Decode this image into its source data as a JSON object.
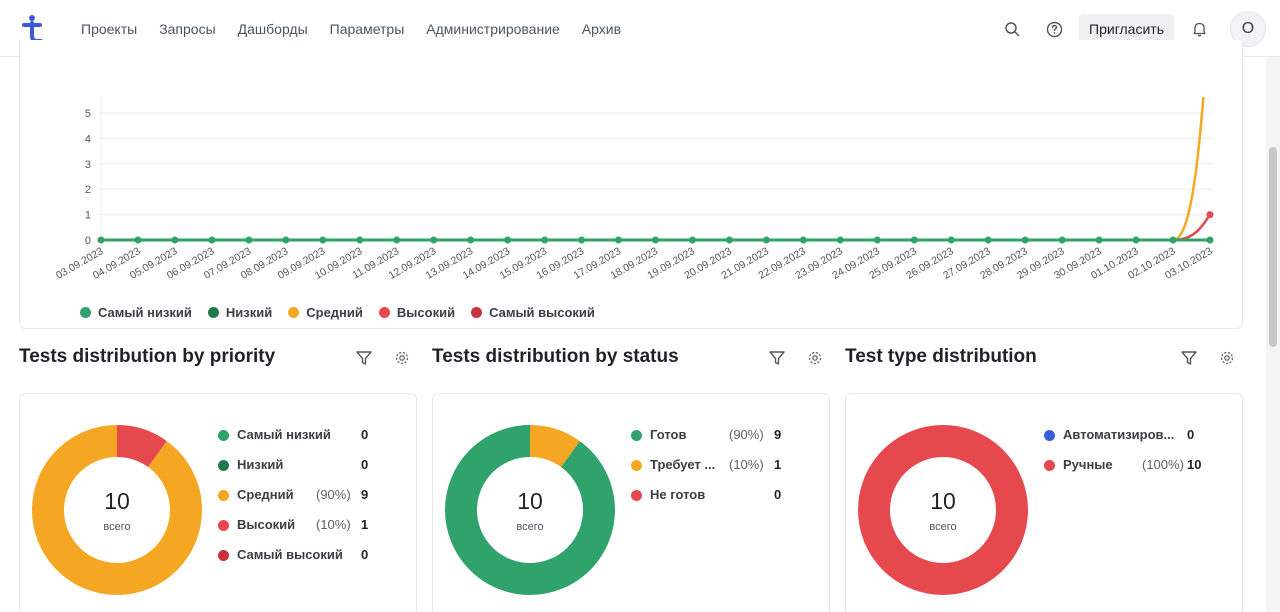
{
  "nav": {
    "items": [
      "Проекты",
      "Запросы",
      "Дашборды",
      "Параметры",
      "Администрирование",
      "Архив"
    ],
    "invite_label": "Пригласить",
    "avatar_initial": "О",
    "icons": [
      "search-icon",
      "help-icon",
      "bell-icon"
    ]
  },
  "chart_data": {
    "type": "line",
    "x": [
      "03.09.2023",
      "04.09.2023",
      "05.09.2023",
      "06.09.2023",
      "07.09.2023",
      "08.09.2023",
      "09.09.2023",
      "10.09.2023",
      "11.09.2023",
      "12.09.2023",
      "13.09.2023",
      "14.09.2023",
      "15.09.2023",
      "16.09.2023",
      "17.09.2023",
      "18.09.2023",
      "19.09.2023",
      "20.09.2023",
      "21.09.2023",
      "22.09.2023",
      "23.09.2023",
      "24.09.2023",
      "25.09.2023",
      "26.09.2023",
      "27.09.2023",
      "28.09.2023",
      "29.09.2023",
      "30.09.2023",
      "01.10.2023",
      "02.10.2023",
      "03.10.2023"
    ],
    "y_ticks": [
      0,
      1,
      2,
      3,
      4,
      5
    ],
    "series": [
      {
        "name": "Самый низкий",
        "color": "#2fa36b",
        "values": [
          0,
          0,
          0,
          0,
          0,
          0,
          0,
          0,
          0,
          0,
          0,
          0,
          0,
          0,
          0,
          0,
          0,
          0,
          0,
          0,
          0,
          0,
          0,
          0,
          0,
          0,
          0,
          0,
          0,
          0,
          0
        ]
      },
      {
        "name": "Низкий",
        "color": "#1e7a4c",
        "values": [
          0,
          0,
          0,
          0,
          0,
          0,
          0,
          0,
          0,
          0,
          0,
          0,
          0,
          0,
          0,
          0,
          0,
          0,
          0,
          0,
          0,
          0,
          0,
          0,
          0,
          0,
          0,
          0,
          0,
          0,
          0
        ]
      },
      {
        "name": "Средний",
        "color": "#f5a623",
        "values": [
          0,
          0,
          0,
          0,
          0,
          0,
          0,
          0,
          0,
          0,
          0,
          0,
          0,
          0,
          0,
          0,
          0,
          0,
          0,
          0,
          0,
          0,
          0,
          0,
          0,
          0,
          0,
          0,
          0,
          0,
          9
        ]
      },
      {
        "name": "Высокий",
        "color": "#e5484d",
        "values": [
          0,
          0,
          0,
          0,
          0,
          0,
          0,
          0,
          0,
          0,
          0,
          0,
          0,
          0,
          0,
          0,
          0,
          0,
          0,
          0,
          0,
          0,
          0,
          0,
          0,
          0,
          0,
          0,
          0,
          0,
          1
        ]
      },
      {
        "name": "Самый высокий",
        "color": "#c8323a",
        "values": [
          0,
          0,
          0,
          0,
          0,
          0,
          0,
          0,
          0,
          0,
          0,
          0,
          0,
          0,
          0,
          0,
          0,
          0,
          0,
          0,
          0,
          0,
          0,
          0,
          0,
          0,
          0,
          0,
          0,
          0,
          0
        ]
      }
    ],
    "legend_position": "bottom-left",
    "grid": true
  },
  "widgets": [
    {
      "title": "Tests distribution by priority",
      "total": "10",
      "total_label": "всего",
      "items": [
        {
          "name": "Самый низкий",
          "pct": "",
          "value": "0",
          "color": "#2fa36b"
        },
        {
          "name": "Низкий",
          "pct": "",
          "value": "0",
          "color": "#1e7a4c"
        },
        {
          "name": "Средний",
          "pct": "(90%)",
          "value": "9",
          "color": "#f5a623"
        },
        {
          "name": "Высокий",
          "pct": "(10%)",
          "value": "1",
          "color": "#e5484d"
        },
        {
          "name": "Самый высокий",
          "pct": "",
          "value": "0",
          "color": "#c8323a"
        }
      ],
      "slices": [
        {
          "fraction": 0.9,
          "color": "#f5a623"
        },
        {
          "fraction": 0.1,
          "color": "#e5484d"
        }
      ]
    },
    {
      "title": "Tests distribution by status",
      "total": "10",
      "total_label": "всего",
      "items": [
        {
          "name": "Готов",
          "pct": "(90%)",
          "value": "9",
          "color": "#2fa36b"
        },
        {
          "name": "Требует ...",
          "pct": "(10%)",
          "value": "1",
          "color": "#f5a623"
        },
        {
          "name": "Не готов",
          "pct": "",
          "value": "0",
          "color": "#e5484d"
        }
      ],
      "slices": [
        {
          "fraction": 0.9,
          "color": "#2fa36b"
        },
        {
          "fraction": 0.1,
          "color": "#f5a623"
        }
      ]
    },
    {
      "title": "Test type distribution",
      "total": "10",
      "total_label": "всего",
      "items": [
        {
          "name": "Автоматизиров...",
          "pct": "",
          "value": "0",
          "color": "#3b5bdb"
        },
        {
          "name": "Ручные",
          "pct": "(100%)",
          "value": "10",
          "color": "#e5484d"
        }
      ],
      "slices": [
        {
          "fraction": 1.0,
          "color": "#e5484d"
        }
      ]
    }
  ]
}
